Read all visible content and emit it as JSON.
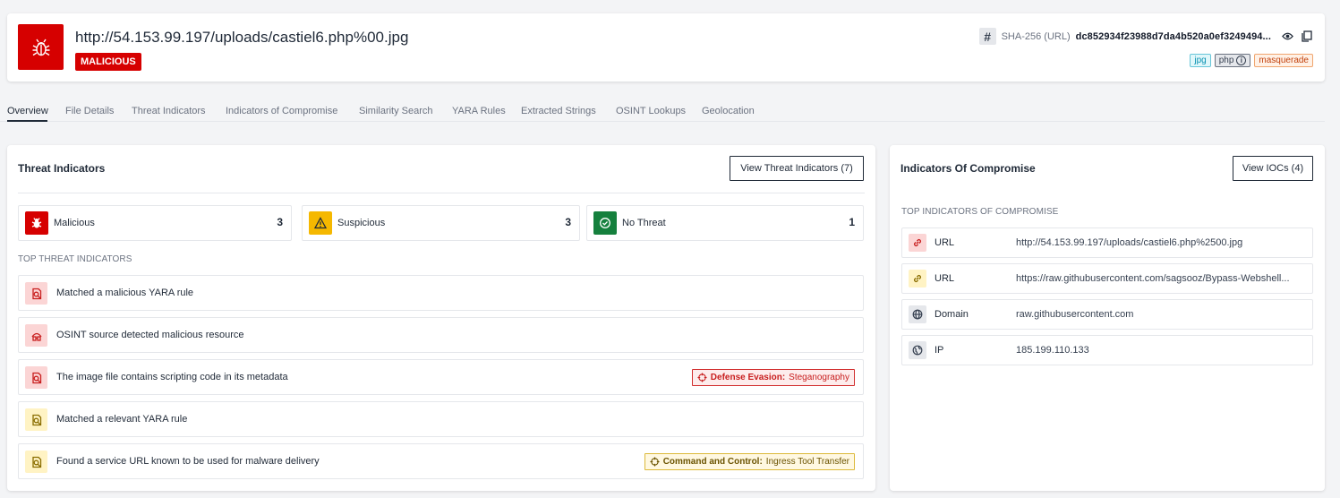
{
  "header": {
    "url_title": "http://54.153.99.197/uploads/castiel6.php%00.jpg",
    "verdict": "MALICIOUS",
    "hash_symbol": "#",
    "hash_label": "SHA-256 (URL)",
    "hash_value": "dc852934f23988d7da4b520a0ef3249494...",
    "tags": [
      "jpg",
      "php",
      "masquerade"
    ]
  },
  "tabs": [
    "Overview",
    "File Details",
    "Threat Indicators",
    "Indicators of Compromise",
    "Similarity Search",
    "YARA Rules",
    "Extracted Strings",
    "OSINT Lookups",
    "Geolocation"
  ],
  "threat_indicators": {
    "title": "Threat Indicators",
    "view_button": "View Threat Indicators (7)",
    "stats": [
      {
        "label": "Malicious",
        "count": "3",
        "color": "#d60000"
      },
      {
        "label": "Suspicious",
        "count": "3",
        "color": "#f5b800"
      },
      {
        "label": "No Threat",
        "count": "1",
        "color": "#15803d"
      }
    ],
    "section_label": "TOP THREAT INDICATORS",
    "items": [
      {
        "text": "Matched a malicious YARA rule",
        "severity": "malicious",
        "icon": "yara-match-icon"
      },
      {
        "text": "OSINT source detected malicious resource",
        "severity": "malicious",
        "icon": "osint-icon"
      },
      {
        "text": "The image file contains scripting code in its metadata",
        "severity": "malicious",
        "icon": "yara-match-icon",
        "tactic": "Defense Evasion:",
        "technique": "Steganography"
      },
      {
        "text": "Matched a relevant YARA rule",
        "severity": "suspicious",
        "icon": "yara-match-icon"
      },
      {
        "text": "Found a service URL known to be used for malware delivery",
        "severity": "suspicious",
        "icon": "yara-match-icon",
        "tactic": "Command and Control:",
        "technique": "Ingress Tool Transfer"
      }
    ]
  },
  "iocs": {
    "title": "Indicators Of Compromise",
    "view_button": "View IOCs (4)",
    "section_label": "TOP INDICATORS OF COMPROMISE",
    "items": [
      {
        "type": "URL",
        "value": "http://54.153.99.197/uploads/castiel6.php%2500.jpg",
        "severity": "malicious",
        "icon": "link-icon"
      },
      {
        "type": "URL",
        "value": "https://raw.githubusercontent.com/sagsooz/Bypass-Webshell...",
        "severity": "suspicious",
        "icon": "link-icon"
      },
      {
        "type": "Domain",
        "value": "raw.githubusercontent.com",
        "severity": "neutral",
        "icon": "globe-icon"
      },
      {
        "type": "IP",
        "value": "185.199.110.133",
        "severity": "neutral",
        "icon": "ip-globe-icon"
      }
    ]
  }
}
